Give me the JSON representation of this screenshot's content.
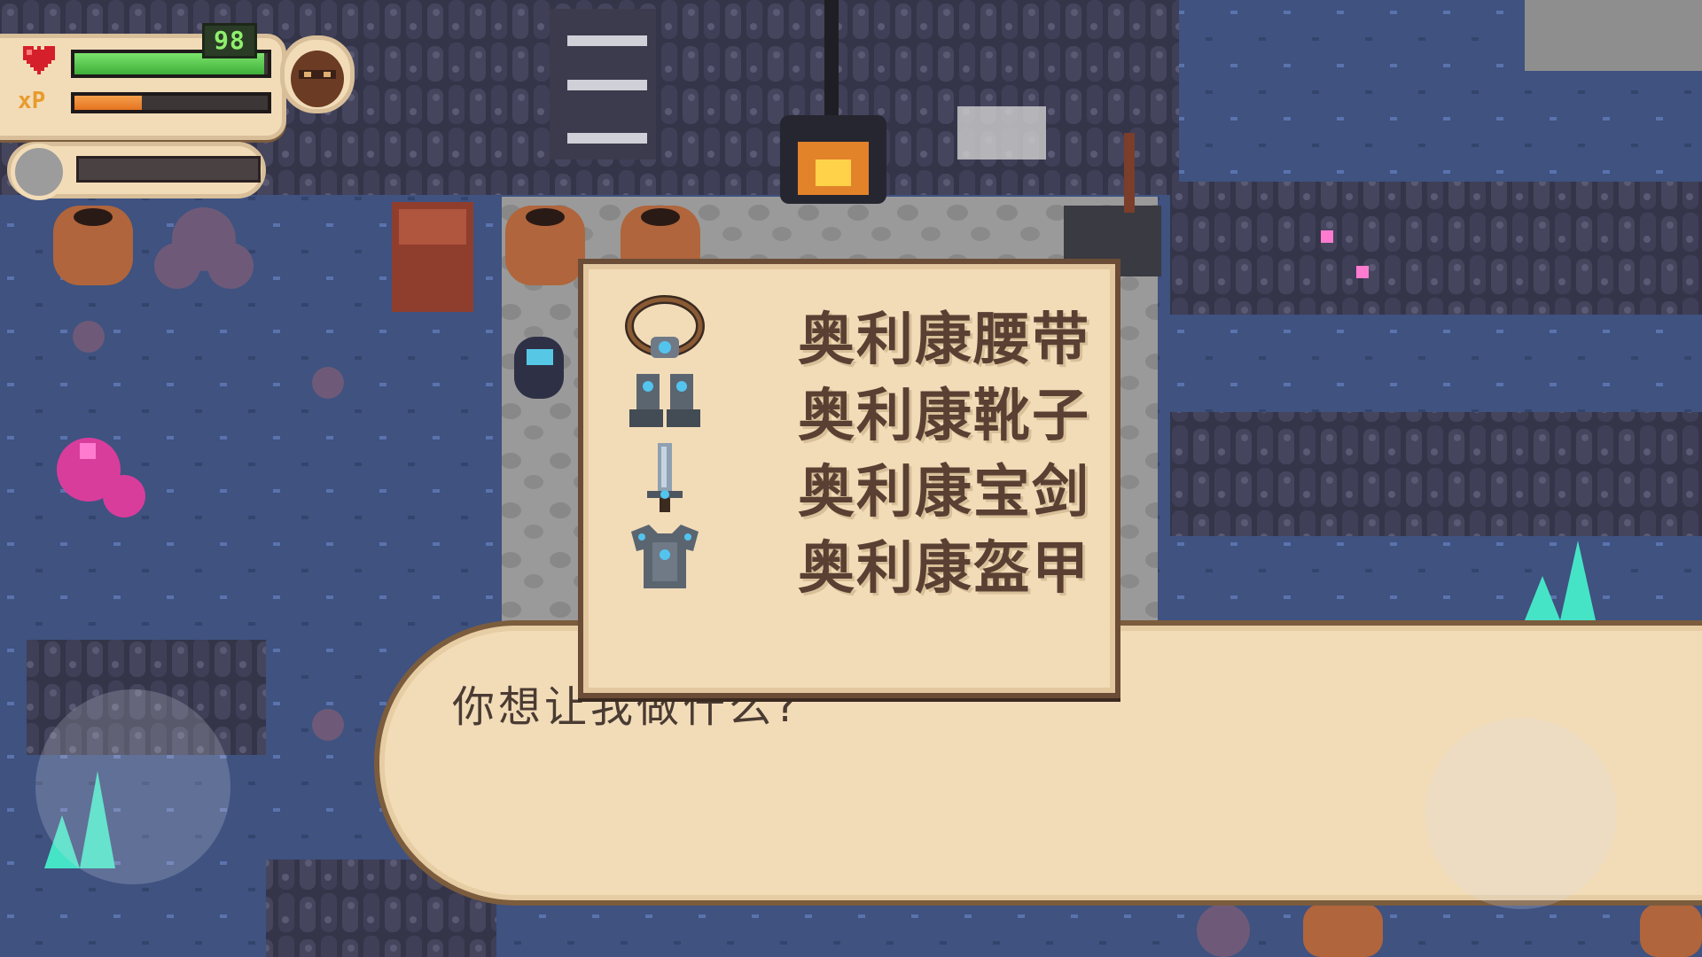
{
  "hud": {
    "health_value": "98",
    "health_fraction": 0.98,
    "xp_label": "xP",
    "xp_fraction": 0.35
  },
  "menu": {
    "items": [
      {
        "label": "奥利康腰带",
        "icon": "belt-icon"
      },
      {
        "label": "奥利康靴子",
        "icon": "boots-icon"
      },
      {
        "label": "奥利康宝剑",
        "icon": "sword-icon"
      },
      {
        "label": "奥利康盔甲",
        "icon": "armor-icon"
      }
    ]
  },
  "dialog": {
    "visible_text": "你想让我做什么?"
  },
  "colors": {
    "health": "#4fc244",
    "xp": "#ee8a34",
    "panel": "#f2dcb8",
    "panel_border": "#7b5c3d"
  }
}
